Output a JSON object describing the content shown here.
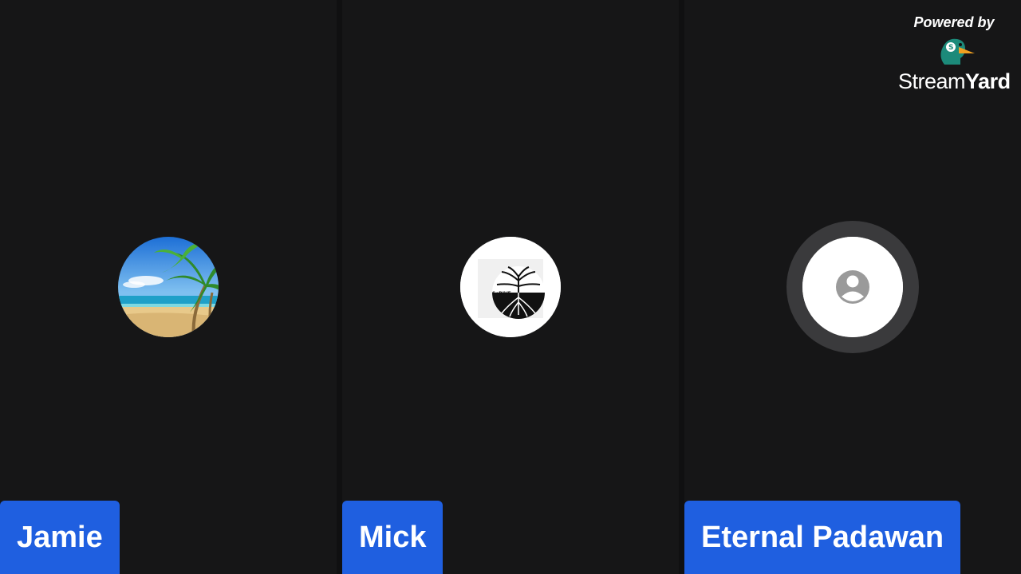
{
  "participants": [
    {
      "name": "Jamie",
      "avatar": "beach-palm-photo"
    },
    {
      "name": "Mick",
      "avatar": "tree-roots-logo"
    },
    {
      "name": "Eternal Padawan",
      "avatar": "default-user-icon"
    }
  ],
  "branding": {
    "powered_by": "Powered by",
    "brand_name_part1": "Stream",
    "brand_name_part2": "Yard"
  },
  "colors": {
    "background": "#161617",
    "name_tag": "#1f5fe0",
    "avatar_ring": "#3a3a3c"
  }
}
